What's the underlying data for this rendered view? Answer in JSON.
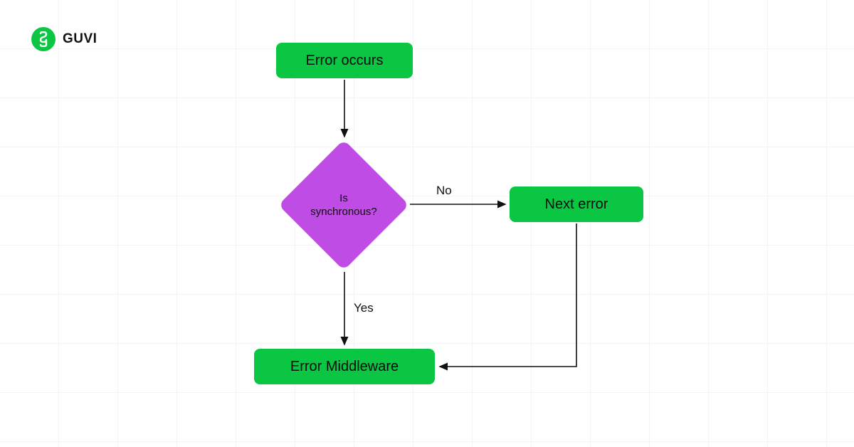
{
  "brand": {
    "name": "GUVI",
    "accent": "#0bc643"
  },
  "flow": {
    "nodes": {
      "start": {
        "label": "Error occurs"
      },
      "decision": {
        "line1": "Is",
        "line2": "synchronous?"
      },
      "next": {
        "label": "Next error"
      },
      "end": {
        "label": "Error Middleware"
      }
    },
    "edges": {
      "no": "No",
      "yes": "Yes"
    }
  },
  "colors": {
    "green": "#0bc643",
    "purple": "#c04ce6",
    "arrow": "#111111"
  }
}
